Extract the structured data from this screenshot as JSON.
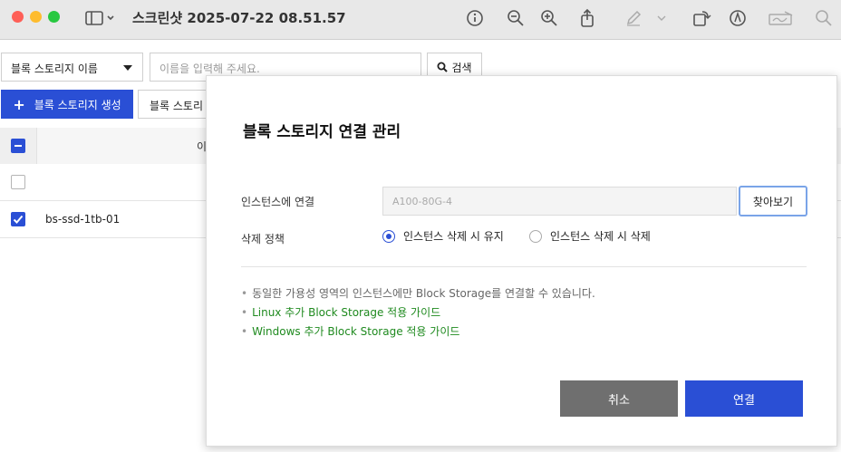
{
  "window": {
    "title": "스크린샷 2025-07-22 08.51.57"
  },
  "toolbar": {
    "select_label": "블록 스토리지 이름",
    "search_placeholder": "이름을 입력해 주세요.",
    "search_button": "검색",
    "create_button": "블록 스토리지 생성",
    "second_button": "블록 스토리"
  },
  "table": {
    "header_name": "이름",
    "rows": [
      {
        "name": "",
        "checked": false
      },
      {
        "name": "bs-ssd-1tb-01",
        "checked": true
      }
    ]
  },
  "modal": {
    "title": "블록 스토리지 연결 관리",
    "instance_label": "인스턴스에 연결",
    "instance_value": "A100-80G-4",
    "browse_button": "찾아보기",
    "policy_label": "삭제 정책",
    "radio_keep": "인스턴스 삭제 시 유지",
    "radio_delete": "인스턴스 삭제 시 삭제",
    "notes": [
      "동일한 가용성 영역의 인스턴스에만 Block Storage를 연결할 수 있습니다.",
      "Linux 추가 Block Storage 적용 가이드",
      "Windows 추가 Block Storage 적용 가이드"
    ],
    "cancel_button": "취소",
    "connect_button": "연결"
  },
  "colors": {
    "primary": "#2a4fd5",
    "link_green": "#1f8a1f",
    "cancel_gray": "#6f6f6f"
  }
}
